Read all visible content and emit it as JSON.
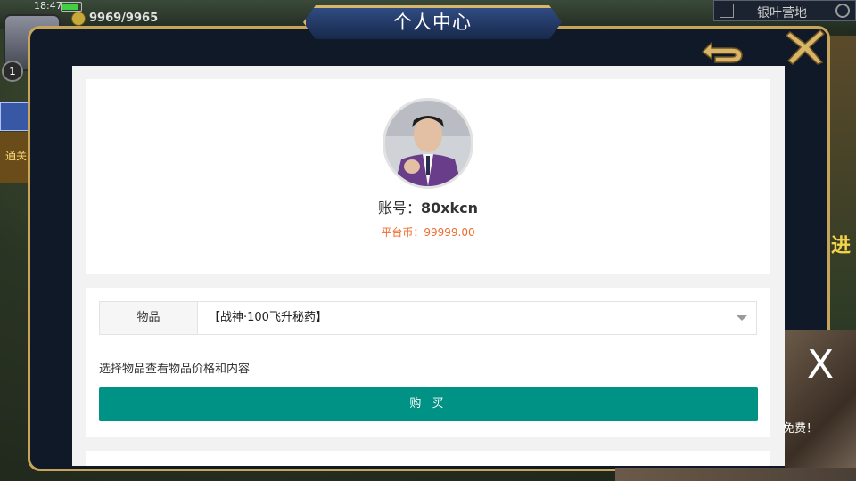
{
  "status_bar": {
    "time": "18:47",
    "gold": "9969/9965"
  },
  "hud": {
    "level": "1",
    "left_task_text": "通关",
    "scene_name": "银叶营地",
    "right_text": "进"
  },
  "window": {
    "title": "个人中心",
    "back_icon": "back-arrow-icon",
    "close_icon": "close-x-icon"
  },
  "profile": {
    "account_label": "账号：",
    "account_value": "80xkcn",
    "platform_coin_label": "平台币：",
    "platform_coin_value": "99999.00"
  },
  "purchase": {
    "item_label": "物品",
    "item_value": "【战神·100飞升秘药】",
    "hint": "选择物品查看物品价格和内容",
    "buy_label": "购 买"
  },
  "ad": {
    "close": "X",
    "free_text": "免费！"
  },
  "colors": {
    "accent": "#009285",
    "coin": "#f06a2b",
    "frame_gold": "#c8a45a"
  }
}
